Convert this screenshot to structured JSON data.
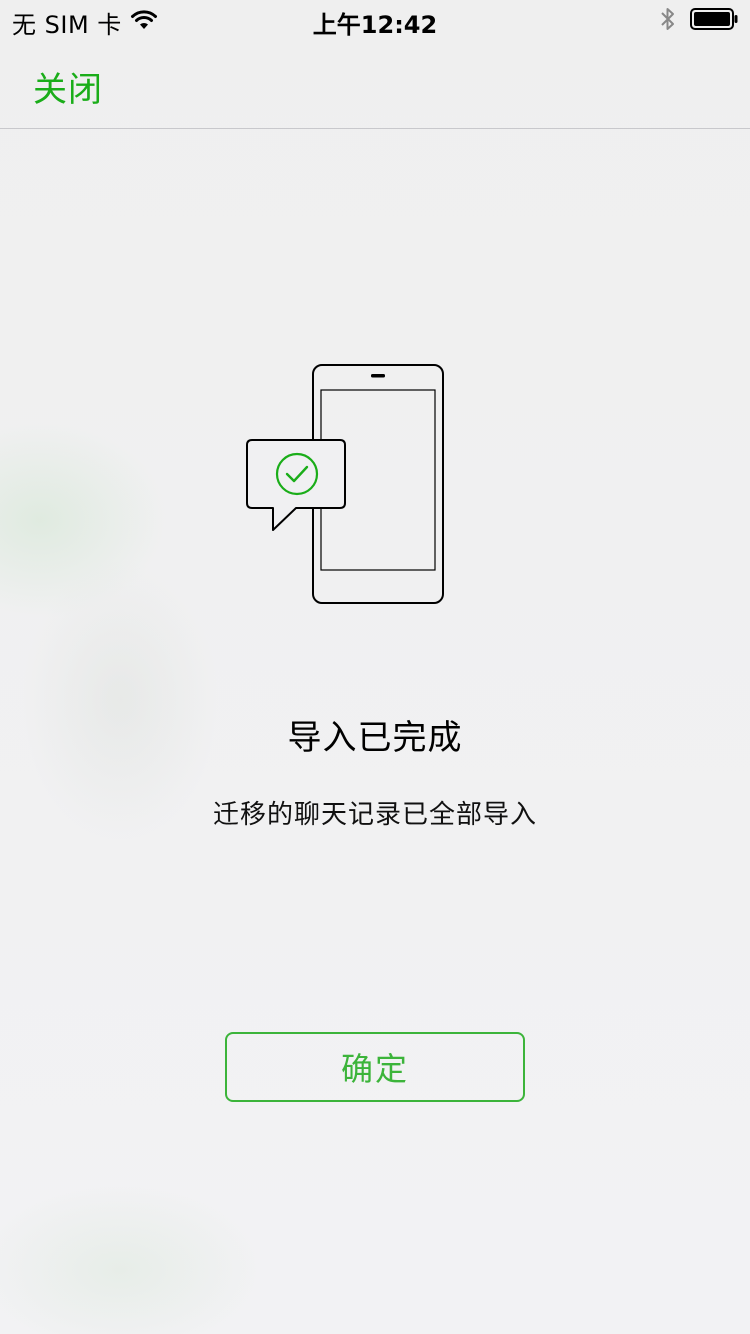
{
  "status_bar": {
    "carrier": "无 SIM 卡",
    "time": "上午12:42",
    "icons": [
      "wifi-icon",
      "bluetooth-icon",
      "battery-icon"
    ]
  },
  "nav": {
    "close_label": "关闭"
  },
  "main": {
    "illustration": "phone-with-check-bubble",
    "title": "导入已完成",
    "subtitle": "迁移的聊天记录已全部导入",
    "confirm_label": "确定"
  },
  "colors": {
    "accent": "#1aad19",
    "button_border": "#3cb43a",
    "background": "#f0f0f2"
  }
}
